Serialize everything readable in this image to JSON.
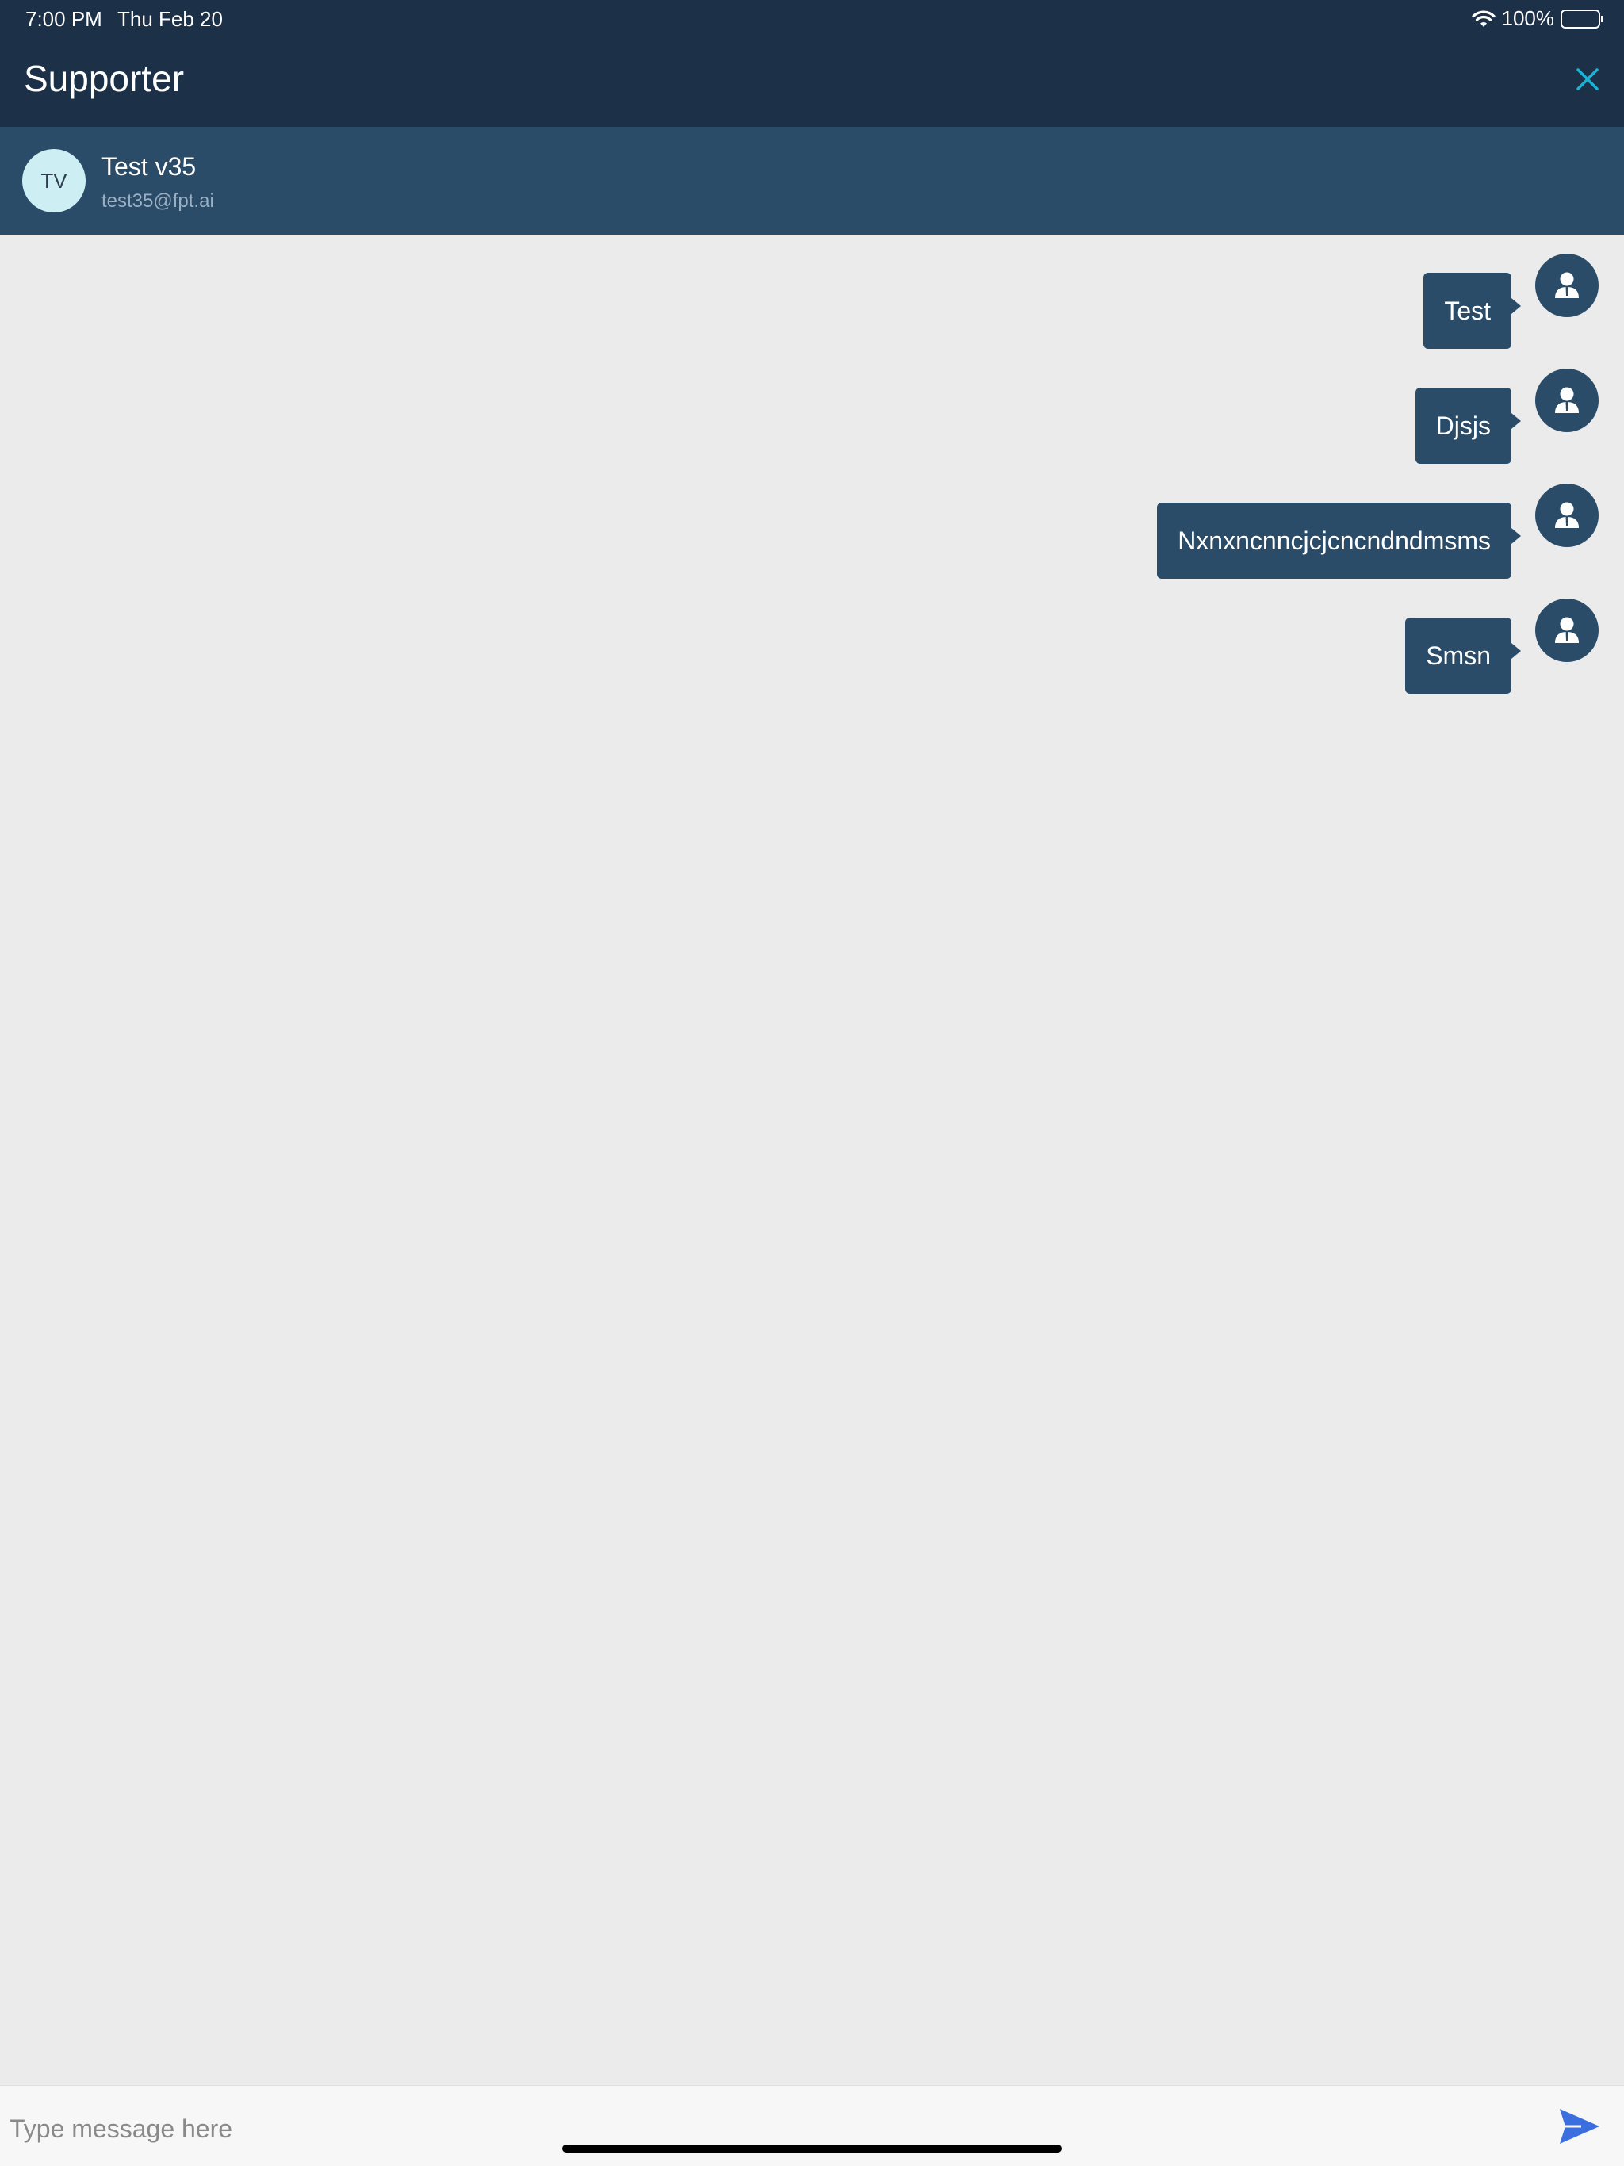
{
  "status_bar": {
    "time": "7:00 PM",
    "date": "Thu Feb 20",
    "battery": "100%"
  },
  "header": {
    "title": "Supporter",
    "close_icon": "close-icon"
  },
  "contact": {
    "initials": "TV",
    "name": "Test v35",
    "email": "test35@fpt.ai"
  },
  "messages": [
    {
      "text": "Test"
    },
    {
      "text": "Djsjs"
    },
    {
      "text": "Nxnxncnncjcjcncndndmsms"
    },
    {
      "text": "Smsn"
    }
  ],
  "composer": {
    "placeholder": "Type message here",
    "value": "",
    "send_icon": "send-icon"
  },
  "colors": {
    "header_bg": "#1c3047",
    "contact_bar_bg": "#2a4c69",
    "bubble_bg": "#2a4c69",
    "accent": "#1ab3d6",
    "send": "#3b6fe0"
  }
}
